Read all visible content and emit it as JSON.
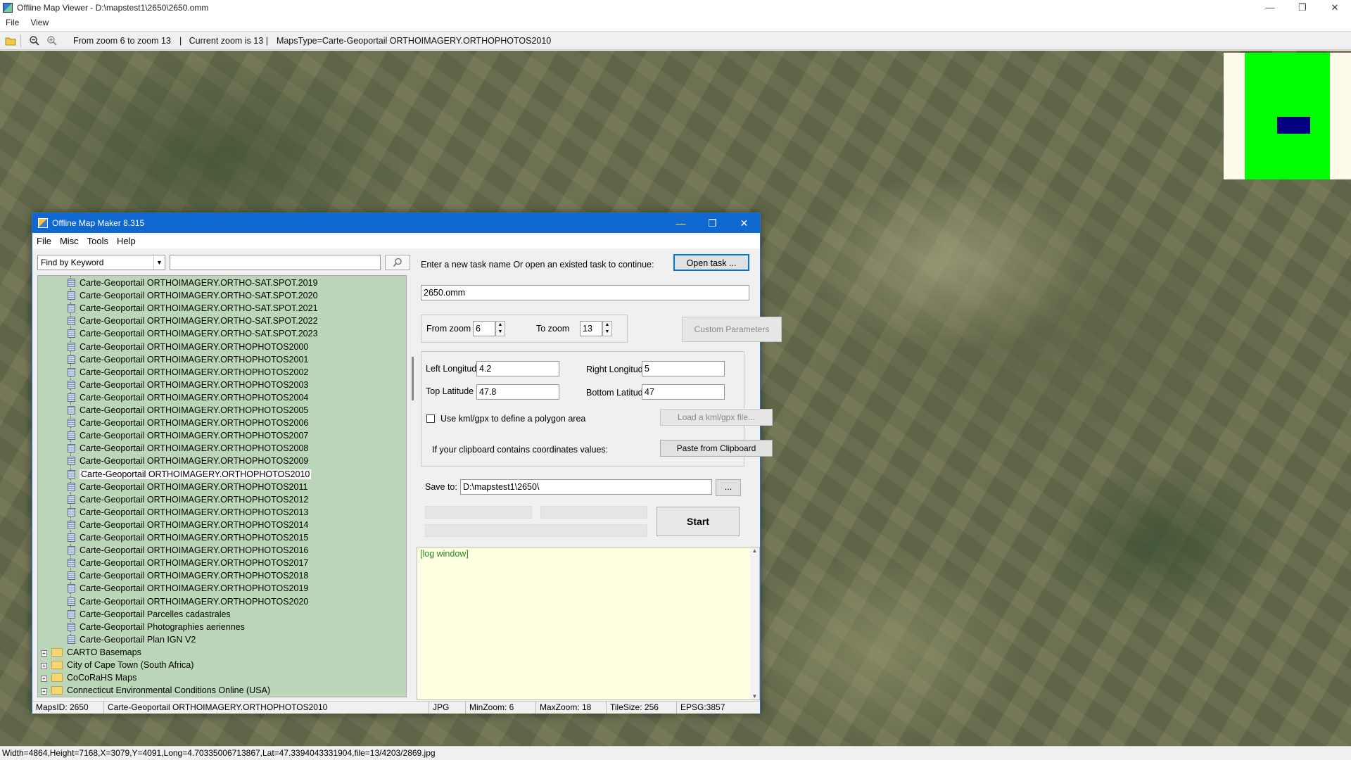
{
  "window": {
    "title": "Offline Map Viewer - D:\\mapstest1\\2650\\2650.omm",
    "controls": [
      "—",
      "❐",
      "✕"
    ]
  },
  "menu": {
    "file": "File",
    "view": "View"
  },
  "toolbar": {
    "zoom_range": "From zoom 6 to zoom 13",
    "current_zoom": "|   Current zoom is 13 |",
    "maps_type": "MapsType=Carte-Geoportail ORTHOIMAGERY.ORTHOPHOTOS2010"
  },
  "statusbar": {
    "text": "Width=4864,Height=7168,X=3079,Y=4091,Long=4.70335006713867,Lat=47.3394043331904,file=13/4203/2869.jpg"
  },
  "dialog": {
    "title": "Offline Map Maker 8.315",
    "menu": {
      "file": "File",
      "misc": "Misc",
      "tools": "Tools",
      "help": "Help"
    },
    "find": {
      "mode": "Find by Keyword",
      "query": ""
    },
    "tree": {
      "children": [
        "Carte-Geoportail ORTHOIMAGERY.ORTHO-SAT.SPOT.2019",
        "Carte-Geoportail ORTHOIMAGERY.ORTHO-SAT.SPOT.2020",
        "Carte-Geoportail ORTHOIMAGERY.ORTHO-SAT.SPOT.2021",
        "Carte-Geoportail ORTHOIMAGERY.ORTHO-SAT.SPOT.2022",
        "Carte-Geoportail ORTHOIMAGERY.ORTHO-SAT.SPOT.2023",
        "Carte-Geoportail ORTHOIMAGERY.ORTHOPHOTOS2000",
        "Carte-Geoportail ORTHOIMAGERY.ORTHOPHOTOS2001",
        "Carte-Geoportail ORTHOIMAGERY.ORTHOPHOTOS2002",
        "Carte-Geoportail ORTHOIMAGERY.ORTHOPHOTOS2003",
        "Carte-Geoportail ORTHOIMAGERY.ORTHOPHOTOS2004",
        "Carte-Geoportail ORTHOIMAGERY.ORTHOPHOTOS2005",
        "Carte-Geoportail ORTHOIMAGERY.ORTHOPHOTOS2006",
        "Carte-Geoportail ORTHOIMAGERY.ORTHOPHOTOS2007",
        "Carte-Geoportail ORTHOIMAGERY.ORTHOPHOTOS2008",
        "Carte-Geoportail ORTHOIMAGERY.ORTHOPHOTOS2009",
        "Carte-Geoportail ORTHOIMAGERY.ORTHOPHOTOS2010",
        "Carte-Geoportail ORTHOIMAGERY.ORTHOPHOTOS2011",
        "Carte-Geoportail ORTHOIMAGERY.ORTHOPHOTOS2012",
        "Carte-Geoportail ORTHOIMAGERY.ORTHOPHOTOS2013",
        "Carte-Geoportail ORTHOIMAGERY.ORTHOPHOTOS2014",
        "Carte-Geoportail ORTHOIMAGERY.ORTHOPHOTOS2015",
        "Carte-Geoportail ORTHOIMAGERY.ORTHOPHOTOS2016",
        "Carte-Geoportail ORTHOIMAGERY.ORTHOPHOTOS2017",
        "Carte-Geoportail ORTHOIMAGERY.ORTHOPHOTOS2018",
        "Carte-Geoportail ORTHOIMAGERY.ORTHOPHOTOS2019",
        "Carte-Geoportail ORTHOIMAGERY.ORTHOPHOTOS2020",
        "Carte-Geoportail Parcelles cadastrales",
        "Carte-Geoportail Photographies aeriennes",
        "Carte-Geoportail Plan IGN V2"
      ],
      "selected": "Carte-Geoportail ORTHOIMAGERY.ORTHOPHOTOS2010",
      "folders": [
        "CARTO Basemaps",
        "City of Cape Town (South Africa)",
        "CoCoRaHS Maps",
        "Connecticut Environmental Conditions Online (USA)"
      ]
    },
    "task": {
      "prompt": "Enter a new task name Or open an existed task to continue:",
      "open_button": "Open task ...",
      "name": "2650.omm"
    },
    "zoom": {
      "from_label": "From zoom",
      "from_value": "6",
      "to_label": "To zoom",
      "to_value": "13",
      "custom_button": "Custom Parameters"
    },
    "bounds": {
      "left_lon_label": "Left Longitude",
      "left_lon": "4.2",
      "right_lon_label": "Right Longitude",
      "right_lon": "5",
      "top_lat_label": "Top Latitude",
      "top_lat": "47.8",
      "bottom_lat_label": "Bottom Latitude",
      "bottom_lat": "47",
      "kml_label": "Use kml/gpx to define a polygon area",
      "kml_checked": false,
      "kml_button": "Load a kml/gpx file...",
      "clipboard_label": "If your clipboard contains coordinates values:",
      "clipboard_button": "Paste from Clipboard"
    },
    "save": {
      "label": "Save to:",
      "path": "D:\\mapstest1\\2650\\",
      "browse_button": "...",
      "start_button": "Start"
    },
    "log": {
      "text": "[log window]"
    },
    "status": {
      "maps_id": "MapsID: 2650",
      "maps_name": "Carte-Geoportail ORTHOIMAGERY.ORTHOPHOTOS2010",
      "format": "JPG",
      "min_zoom": "MinZoom: 6",
      "max_zoom": "MaxZoom: 18",
      "tile_size": "TileSize: 256",
      "epsg": "EPSG:3857"
    }
  }
}
